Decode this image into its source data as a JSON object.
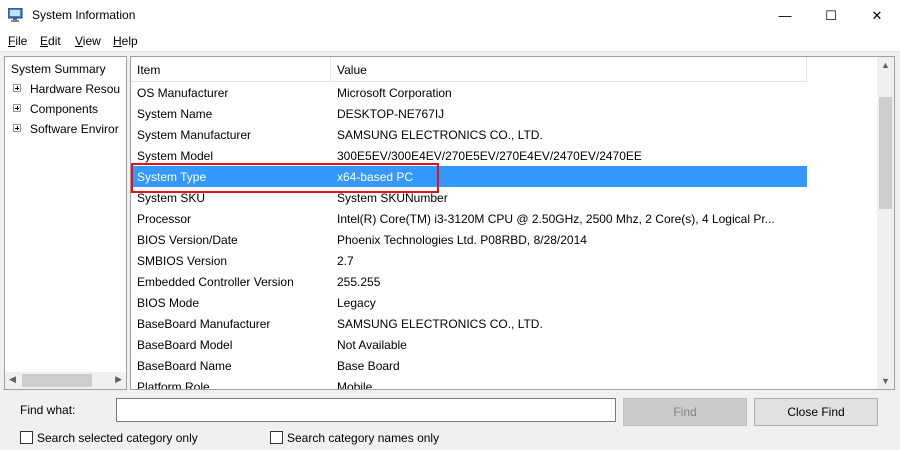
{
  "window": {
    "title": "System Information",
    "controls": {
      "minimize": "—",
      "maximize": "☐",
      "close": "✕"
    }
  },
  "menu": {
    "items": [
      {
        "label": "File",
        "accel": "F",
        "rest": "ile"
      },
      {
        "label": "Edit",
        "accel": "E",
        "rest": "dit"
      },
      {
        "label": "View",
        "accel": "V",
        "rest": "iew"
      },
      {
        "label": "Help",
        "accel": "H",
        "rest": "elp"
      }
    ]
  },
  "tree": {
    "root": "System Summary",
    "items": [
      {
        "label": "Hardware Resou",
        "expandable": true
      },
      {
        "label": "Components",
        "expandable": true
      },
      {
        "label": "Software Enviror",
        "expandable": true
      }
    ],
    "scroll": {
      "left": "◀",
      "right": "▶"
    }
  },
  "table": {
    "headers": {
      "item": "Item",
      "value": "Value"
    },
    "rows": [
      {
        "item": "OS Manufacturer",
        "value": "Microsoft Corporation"
      },
      {
        "item": "System Name",
        "value": "DESKTOP-NE767IJ"
      },
      {
        "item": "System Manufacturer",
        "value": "SAMSUNG ELECTRONICS CO., LTD."
      },
      {
        "item": "System Model",
        "value": "300E5EV/300E4EV/270E5EV/270E4EV/2470EV/2470EE"
      },
      {
        "item": "System Type",
        "value": "x64-based PC",
        "selected": true
      },
      {
        "item": "System SKU",
        "value": "System SKUNumber"
      },
      {
        "item": "Processor",
        "value": "Intel(R) Core(TM) i3-3120M CPU @ 2.50GHz, 2500 Mhz, 2 Core(s), 4 Logical Pr..."
      },
      {
        "item": "BIOS Version/Date",
        "value": "Phoenix Technologies Ltd. P08RBD, 8/28/2014"
      },
      {
        "item": "SMBIOS Version",
        "value": "2.7"
      },
      {
        "item": "Embedded Controller Version",
        "value": "255.255"
      },
      {
        "item": "BIOS Mode",
        "value": "Legacy"
      },
      {
        "item": "BaseBoard Manufacturer",
        "value": "SAMSUNG ELECTRONICS CO., LTD."
      },
      {
        "item": "BaseBoard Model",
        "value": "Not Available"
      },
      {
        "item": "BaseBoard Name",
        "value": "Base Board"
      },
      {
        "item": "Platform Role",
        "value": "Mobile"
      }
    ],
    "scroll": {
      "up": "▲",
      "down": "▼"
    },
    "selection_color": "#3399ff",
    "highlight_color": "#e0141e"
  },
  "find": {
    "label": "Find what:",
    "value": "",
    "find_button": "Find",
    "close_button": "Close Find",
    "opt_selected": "Search selected category only",
    "opt_names": "Search category names only"
  }
}
